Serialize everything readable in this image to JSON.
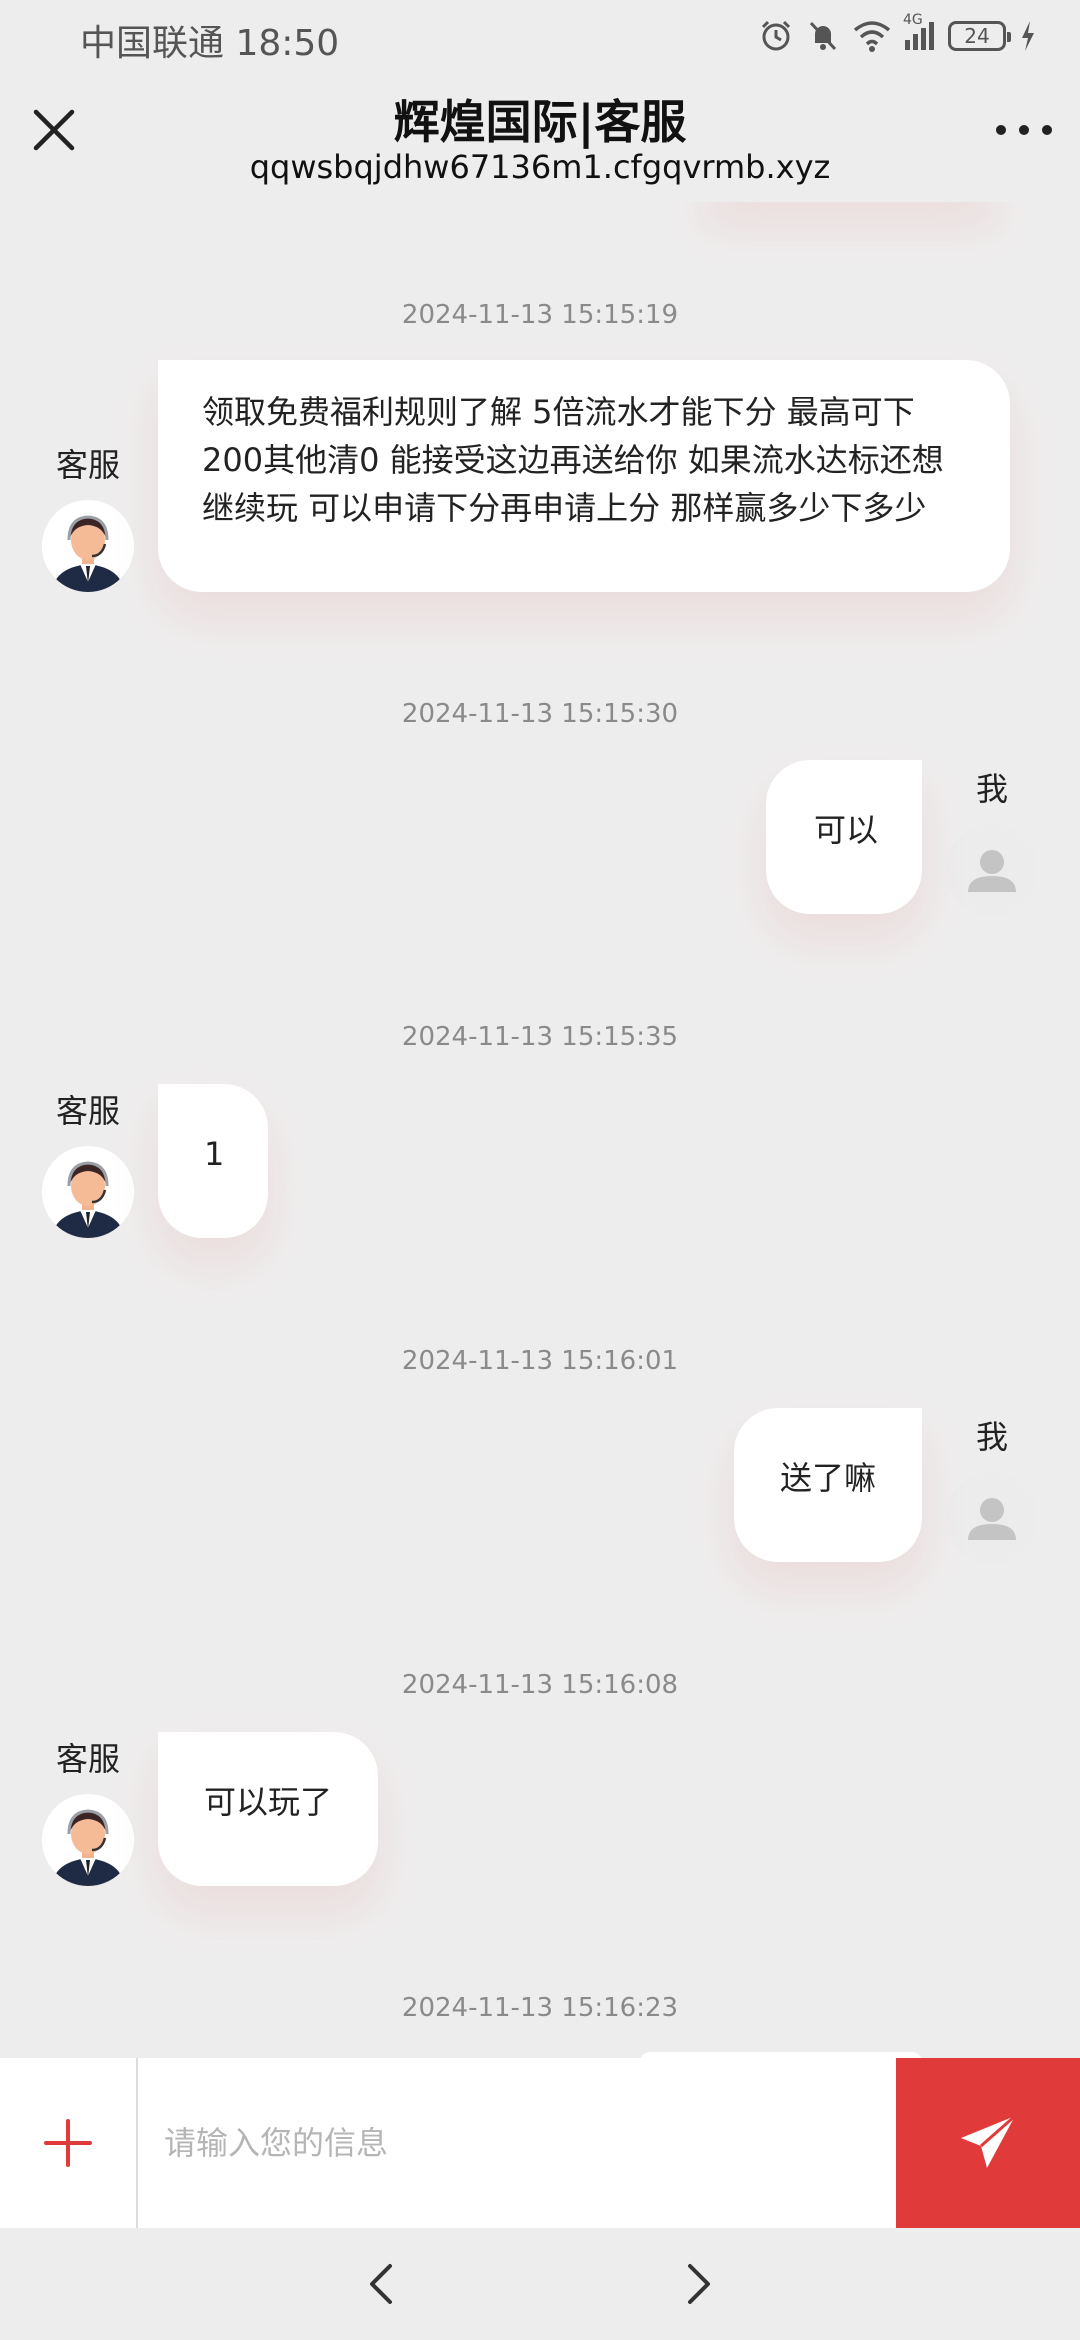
{
  "status_bar": {
    "carrier": "中国联通",
    "time": "18:50",
    "network": "4G",
    "battery": "24"
  },
  "header": {
    "title": "辉煌国际|客服",
    "url": "qqwsbqjdhw67136m1.cfgqvrmb.xyz"
  },
  "messages": [
    {
      "timestamp": "2024-11-13 15:15:19",
      "sender": "客服",
      "lines": [
        "领取免费福利规则了解 5倍流水才能下分 最高可下",
        "200其他清0 能接受这边再送给你 如果流水达标还想",
        "继续玩 可以申请下分再申请上分 那样赢多少下多少"
      ]
    },
    {
      "timestamp": "2024-11-13 15:15:30",
      "sender": "我",
      "text": "可以"
    },
    {
      "timestamp": "2024-11-13 15:15:35",
      "sender": "客服",
      "text": "1"
    },
    {
      "timestamp": "2024-11-13 15:16:01",
      "sender": "我",
      "text": "送了嘛"
    },
    {
      "timestamp": "2024-11-13 15:16:08",
      "sender": "客服",
      "text": "可以玩了"
    },
    {
      "timestamp": "2024-11-13 15:16:23"
    }
  ],
  "input": {
    "placeholder": "请输入您的信息"
  },
  "icons": {
    "close": "close-icon",
    "more": "more-icon",
    "plus": "plus-icon",
    "send": "send-icon",
    "back": "chevron-left-icon",
    "forward": "chevron-right-icon"
  },
  "colors": {
    "accent": "#e03a3a",
    "background": "#eeeded",
    "bubble": "#ffffff"
  }
}
